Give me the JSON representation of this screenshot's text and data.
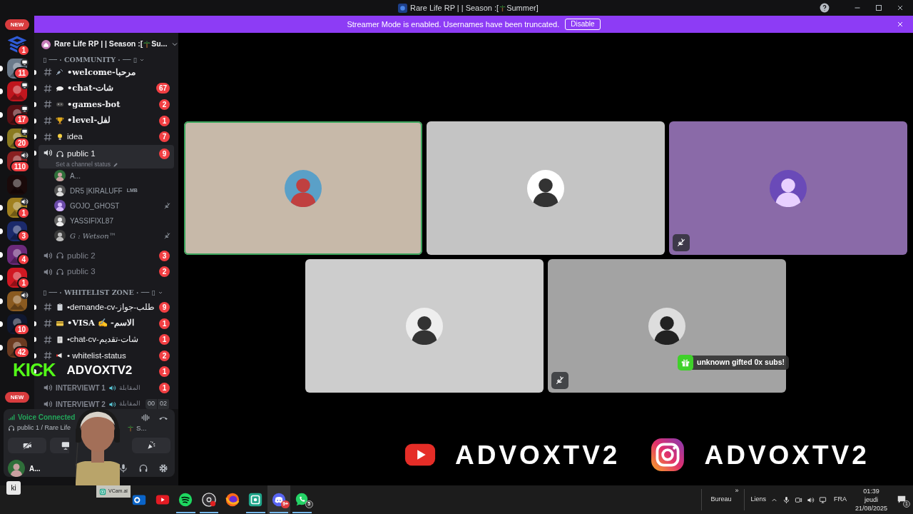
{
  "window": {
    "title_start": "Rare Life RP | | Season :[",
    "title_end": "Summer]"
  },
  "banner": {
    "text": "Streamer Mode is enabled. Usernames have been truncated.",
    "button": "Disable"
  },
  "servers_new_top": "NEW",
  "servers": [
    {
      "color": "#2f5bd8",
      "badge": "1",
      "unread": false,
      "kind": "plain"
    },
    {
      "color": "#6b7a8a",
      "badge": "11",
      "unread": true,
      "kind": "screen"
    },
    {
      "color": "#c0161e",
      "unread": true,
      "kind": "screen"
    },
    {
      "color": "#5a1014",
      "badge": "17",
      "unread": true,
      "kind": "screen"
    },
    {
      "color": "#8a7a20",
      "badge": "20",
      "unread": true,
      "kind": "screen"
    },
    {
      "color": "#8a2020",
      "badge": "110",
      "unread": true,
      "kind": "voice"
    },
    {
      "color": "#1a0a0a",
      "unread": false,
      "kind": "plain"
    },
    {
      "color": "#a08020",
      "badge": "1",
      "unread": true,
      "kind": "voice"
    },
    {
      "color": "#1b2a6b",
      "badge": "3",
      "unread": true,
      "kind": "plain"
    },
    {
      "color": "#6b2a7a",
      "badge": "4",
      "unread": true,
      "kind": "plain"
    },
    {
      "color": "#d01822",
      "badge": "1",
      "unread": true,
      "kind": "plain"
    },
    {
      "color": "#8a5a20",
      "unread": true,
      "kind": "voice"
    },
    {
      "color": "#101830",
      "badge": "10",
      "unread": true,
      "kind": "plain"
    },
    {
      "color": "#6a3a20",
      "badge": "42",
      "unread": true,
      "kind": "plain"
    }
  ],
  "servers_new_bottom": "NEW",
  "server_header": {
    "name_start": "Rare Life RP | | Season :[",
    "name_end": "Su..."
  },
  "channels": [
    {
      "kind": "category",
      "name": "▯ ── · COMMUNITY · ── ▯"
    },
    {
      "kind": "text",
      "name": "•welcome-مرحبا",
      "fancy": true,
      "unread": true
    },
    {
      "kind": "text",
      "name": "•chat-شات",
      "fancy": true,
      "unread": true,
      "badge": "67"
    },
    {
      "kind": "text",
      "name": "•games-bot",
      "fancy": true,
      "unread": true,
      "badge": "2"
    },
    {
      "kind": "text",
      "name": "•level-لفل",
      "fancy": true,
      "unread": true,
      "badge": "1"
    },
    {
      "kind": "text",
      "name": "idea",
      "fancy": false,
      "unread": true,
      "badge": "7"
    },
    {
      "kind": "voice",
      "name": "public 1",
      "unread": true,
      "selected": true,
      "badge": "9",
      "status": "Set a channel status",
      "users": [
        {
          "name": "A...",
          "fancy": false,
          "muted": false
        },
        {
          "name": "DR5 |KIRALUFF",
          "tag": "LMB",
          "fancy": false,
          "muted": false
        },
        {
          "name": "GOJO_GHOST",
          "fancy": false,
          "muted": true
        },
        {
          "name": "YASSIFIXL87",
          "fancy": false,
          "muted": false
        },
        {
          "name": "G : Wetson™",
          "fancy": true,
          "muted": true
        }
      ]
    },
    {
      "kind": "voice",
      "name": "public 2",
      "unread": false,
      "selected": false,
      "badge": "3"
    },
    {
      "kind": "voice",
      "name": "public 3",
      "unread": false,
      "selected": false,
      "badge": "2"
    },
    {
      "kind": "category",
      "name": "▯ ── · WHITELIST ZONE · ── ▯"
    },
    {
      "kind": "text",
      "name": "•demande-cv-طلب-جواز",
      "fancy": false,
      "unread": true,
      "badge": "9"
    },
    {
      "kind": "text",
      "name": "•VISA ✍ -الاسم",
      "fancy": true,
      "unread": true,
      "badge": "1"
    },
    {
      "kind": "text",
      "name": "•chat-cv-شات-تقديم",
      "fancy": false,
      "unread": true,
      "badge": "1"
    },
    {
      "kind": "text",
      "name": "• whitelist-status",
      "fancy": false,
      "unread": true,
      "badge": "2"
    },
    {
      "kind": "hidden",
      "unread": true,
      "badge": "1"
    },
    {
      "kind": "voice",
      "name": "INTERVIEWT 1",
      "suffix": "المقابلة",
      "unread": false,
      "selected": false,
      "badge": "1"
    },
    {
      "kind": "voice",
      "name": "INTERVIEWT 2",
      "suffix": "المقابلة",
      "unread": false,
      "selected": false,
      "timer": [
        "00",
        "02"
      ]
    }
  ],
  "voice_panel": {
    "status": "Voice Connected",
    "location": "public 1 / Rare Life",
    "location_end": "S...",
    "user": "A..."
  },
  "tiles": [
    {
      "color": "#c7b9a9",
      "speaking": true,
      "muted": false
    },
    {
      "color": "#c4c4c4",
      "speaking": false,
      "muted": false
    },
    {
      "color": "#8a6aa8",
      "speaking": false,
      "muted": true
    },
    {
      "color": "#cdcdcd",
      "speaking": false,
      "muted": false
    },
    {
      "color": "#a3a3a3",
      "speaking": false,
      "muted": true
    }
  ],
  "overlay": {
    "kick": "KICK",
    "kick_handle": "ADVOXTV2",
    "gift": "unknown gifted 0x subs!",
    "socials": [
      "ADVOXTV2",
      "ADVOXTV2"
    ]
  },
  "taskbar": {
    "tooltip": "ki",
    "vcam_tooltip": "VCam.ai",
    "apps": [
      {
        "running": false,
        "active": false
      },
      {
        "running": false,
        "active": false
      },
      {
        "running": true,
        "active": false
      },
      {
        "running": true,
        "active": false
      },
      {
        "running": false,
        "active": false
      },
      {
        "running": true,
        "active": false
      },
      {
        "running": true,
        "active": true,
        "badge": "9+"
      },
      {
        "running": true,
        "active": false,
        "badge": "5"
      }
    ],
    "more": "»",
    "toolbar": "Bureau",
    "links": "Liens",
    "language": "FRA",
    "time": "01:39",
    "day": "jeudi",
    "date": "21/08/2025",
    "notifications": "1"
  }
}
